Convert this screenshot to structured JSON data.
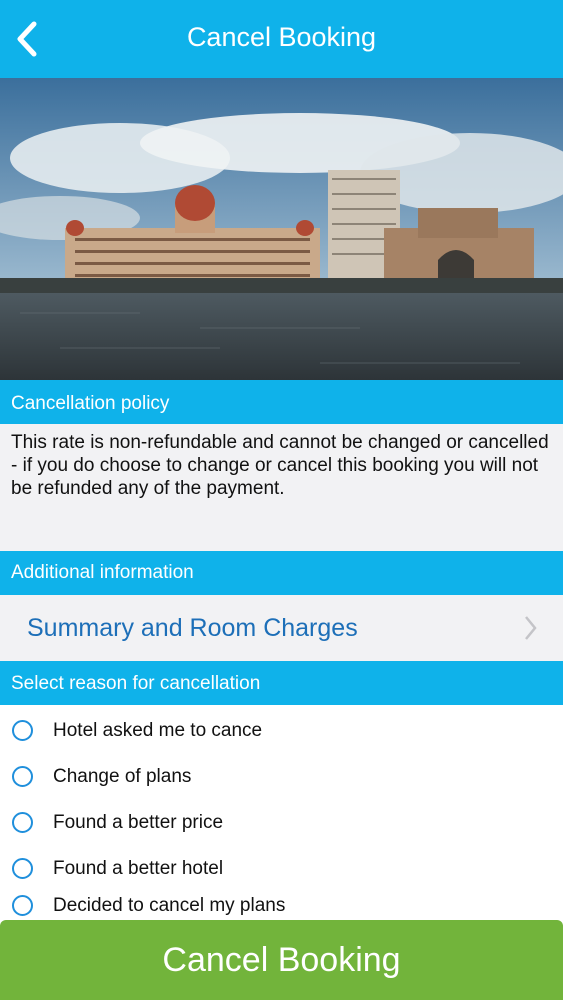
{
  "header": {
    "title": "Cancel Booking",
    "back_icon": "chevron-left-icon"
  },
  "hero": {
    "description_icon": "hotel-photo"
  },
  "policy": {
    "section_title": "Cancellation policy",
    "text": "This rate is non-refundable and cannot be changed or cancelled - if you do choose to change or cancel this booking you will not be refunded any of the payment."
  },
  "additional": {
    "section_title": "Additional information",
    "summary_label": "Summary and Room Charges",
    "chevron_icon": "chevron-right-icon"
  },
  "reasons": {
    "section_title": "Select reason for cancellation",
    "options": [
      " Hotel asked me to cance",
      "Change of plans",
      "Found a better price",
      "Found a better hotel",
      "Decided to cancel my plans"
    ]
  },
  "footer": {
    "cancel_label": "Cancel Booking"
  },
  "colors": {
    "accent": "#0fb2ea",
    "button": "#72b43b",
    "link": "#1d6fb8"
  }
}
